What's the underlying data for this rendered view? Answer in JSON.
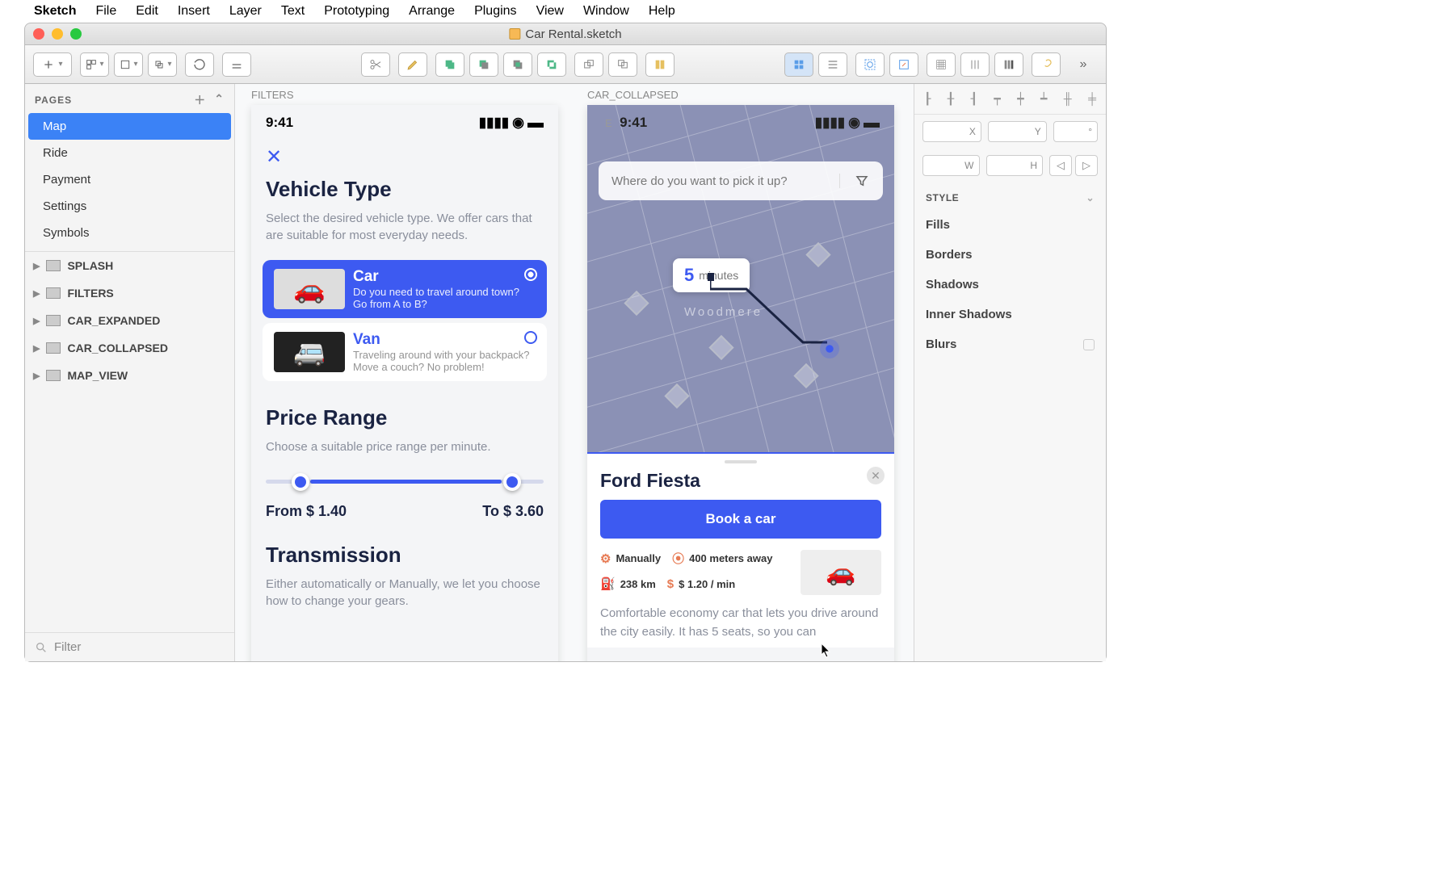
{
  "menubar": {
    "app": "Sketch",
    "items": [
      "File",
      "Edit",
      "Insert",
      "Layer",
      "Text",
      "Prototyping",
      "Arrange",
      "Plugins",
      "View",
      "Window",
      "Help"
    ]
  },
  "document": {
    "title": "Car Rental.sketch"
  },
  "pages_header": {
    "label": "PAGES"
  },
  "pages": [
    {
      "name": "Map",
      "selected": true
    },
    {
      "name": "Ride",
      "selected": false
    },
    {
      "name": "Payment",
      "selected": false
    },
    {
      "name": "Settings",
      "selected": false
    },
    {
      "name": "Symbols",
      "selected": false
    }
  ],
  "layers": [
    {
      "name": "SPLASH"
    },
    {
      "name": "FILTERS"
    },
    {
      "name": "CAR_EXPANDED"
    },
    {
      "name": "CAR_COLLAPSED"
    },
    {
      "name": "MAP_VIEW"
    }
  ],
  "filter_placeholder": "Filter",
  "inspector": {
    "pos_labels": {
      "x": "X",
      "y": "Y",
      "deg": "°",
      "w": "W",
      "h": "H"
    },
    "style_header": "STYLE",
    "sections": [
      "Fills",
      "Borders",
      "Shadows",
      "Inner Shadows",
      "Blurs"
    ]
  },
  "artboard1": {
    "label": "FILTERS",
    "time": "9:41",
    "vehicle_type": {
      "title": "Vehicle Type",
      "desc": "Select the desired vehicle type. We offer cars that are suitable for most everyday needs."
    },
    "vehicles": [
      {
        "title": "Car",
        "desc": "Do you need to travel around town? Go from A to B?",
        "selected": true
      },
      {
        "title": "Van",
        "desc": "Traveling around with your backpack? Move a couch? No problem!",
        "selected": false
      }
    ],
    "price": {
      "title": "Price Range",
      "desc": "Choose a suitable price range per minute.",
      "from_label": "From $ 1.40",
      "to_label": "To $ 3.60"
    },
    "transmission": {
      "title": "Transmission",
      "desc": "Either automatically or Manually, we let you choose how to change your gears."
    }
  },
  "artboard2": {
    "label": "CAR_COLLAPSED",
    "time": "9:41",
    "search_placeholder": "Where do you want to pick it up?",
    "eta": {
      "value": "5",
      "unit": "minutes"
    },
    "map_center_label": "Woodmere",
    "sheet": {
      "car_name": "Ford Fiesta",
      "book_label": "Book a car",
      "specs": {
        "transmission": "Manually",
        "distance": "400 meters away",
        "range": "238 km",
        "price": "$ 1.20 / min"
      },
      "desc": "Comfortable economy car that lets you drive around the city easily. It has 5 seats, so you can"
    }
  }
}
